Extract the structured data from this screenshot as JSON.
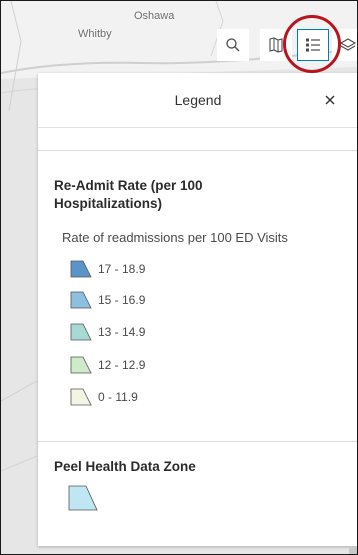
{
  "map": {
    "places": [
      "Oshawa",
      "Whitby"
    ]
  },
  "toolbar": {
    "buttons": [
      {
        "name": "search",
        "icon": "search-icon"
      },
      {
        "name": "basemap",
        "icon": "basemap-icon"
      },
      {
        "name": "legend",
        "icon": "legend-list-icon",
        "active": true
      },
      {
        "name": "layers",
        "icon": "layers-icon"
      }
    ]
  },
  "legend_panel": {
    "title": "Legend",
    "close_label": "×",
    "layers": [
      {
        "title": "Re-Admit Rate (per 100 Hospitalizations)",
        "subtitle": "Rate of readmissions per 100 ED Visits",
        "classes": [
          {
            "label": "17 - 18.9",
            "color": "#5b94c9"
          },
          {
            "label": "15 - 16.9",
            "color": "#8dbfde"
          },
          {
            "label": "13 - 14.9",
            "color": "#a7d9d5"
          },
          {
            "label": "12 - 12.9",
            "color": "#cdebc8"
          },
          {
            "label": "0 - 11.9",
            "color": "#f4f4e4"
          }
        ]
      },
      {
        "title": "Peel Health Data Zone",
        "symbol_color": "#bfe6f3"
      }
    ]
  },
  "colors": {
    "accent": "#0079c1",
    "highlight_ring": "#b8141e"
  }
}
